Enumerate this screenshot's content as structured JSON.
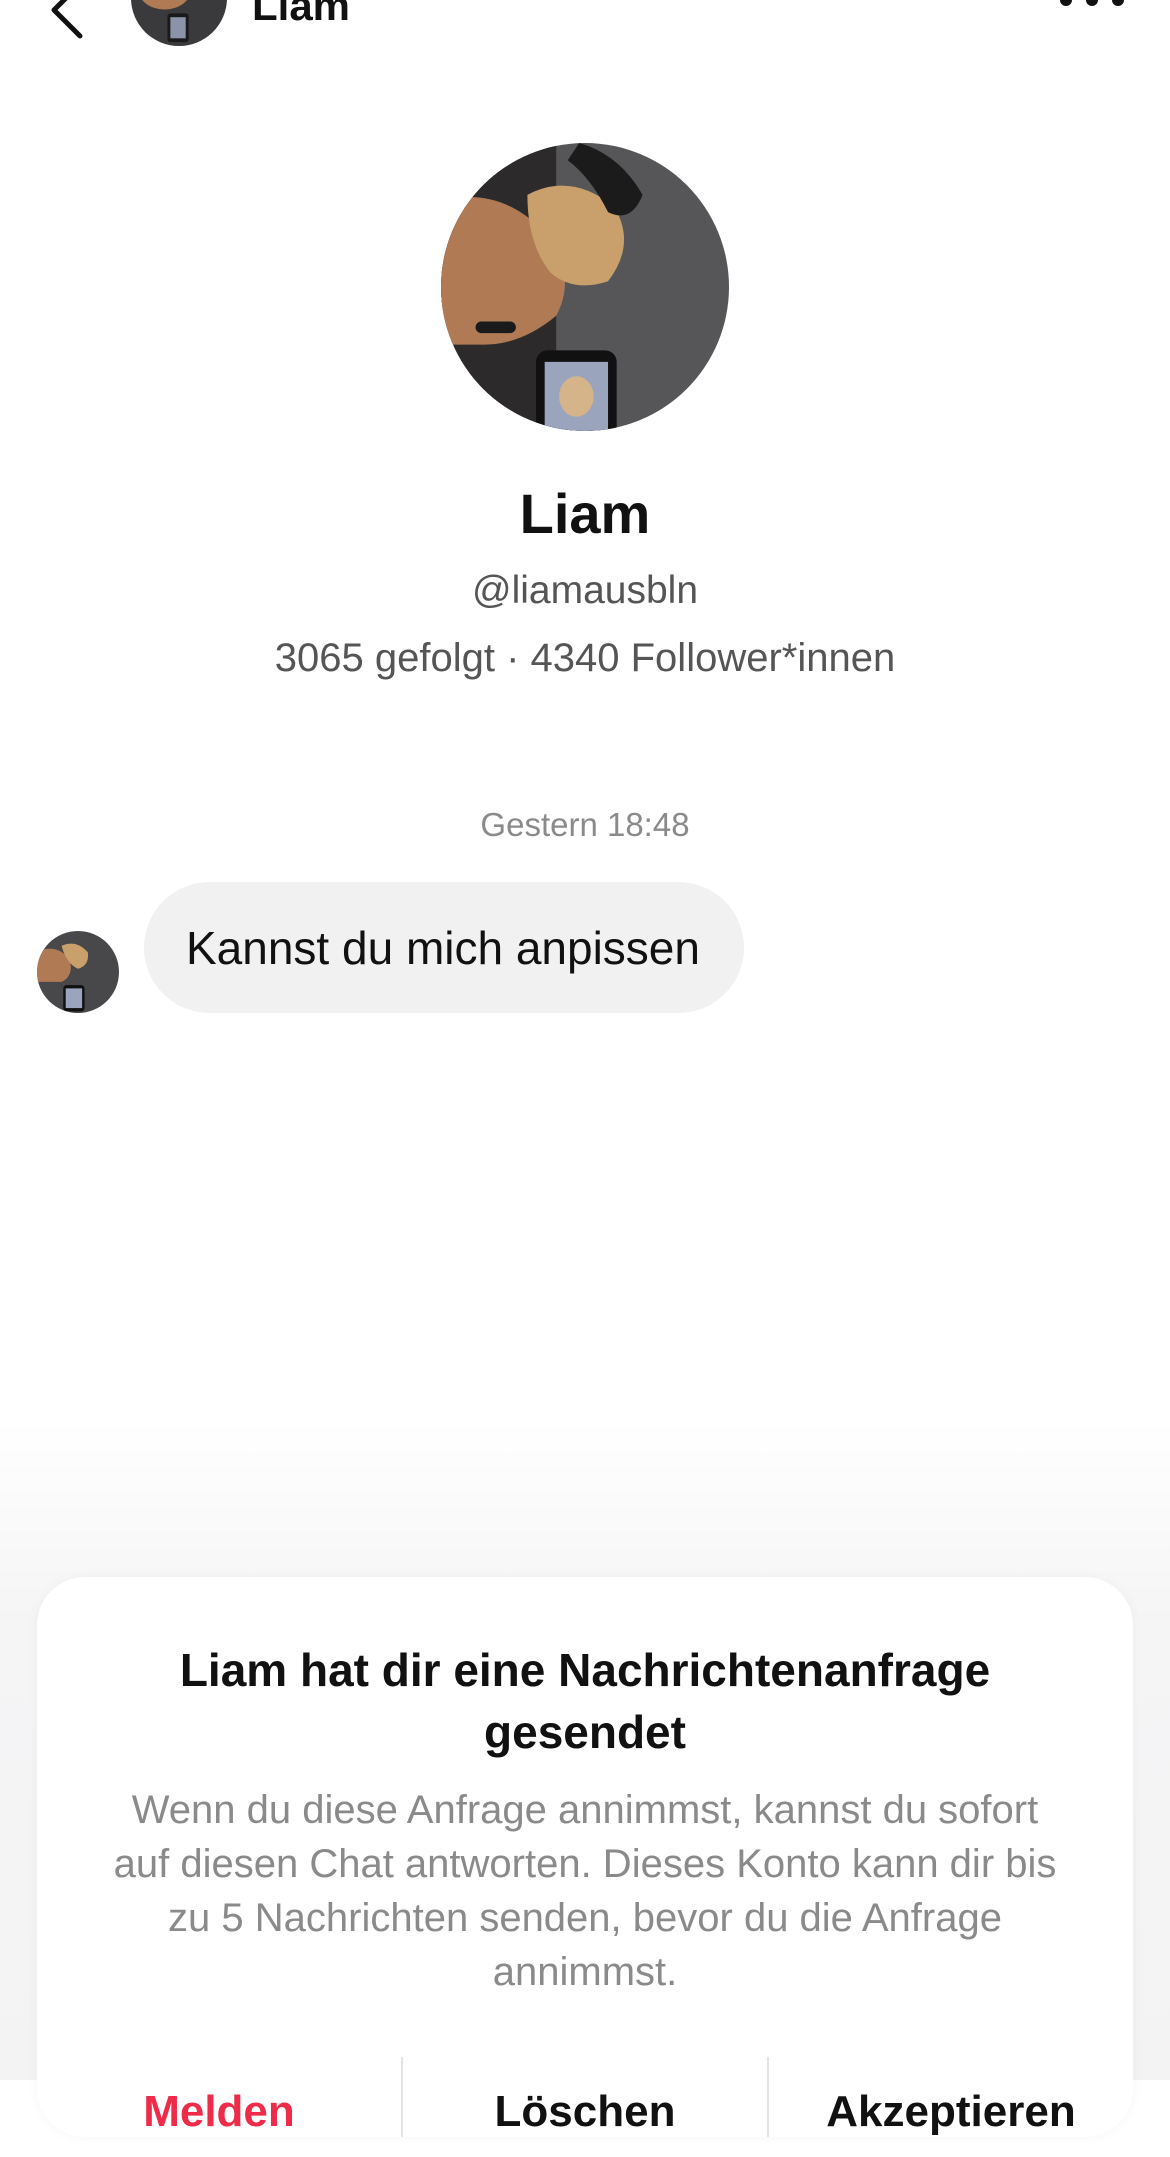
{
  "header": {
    "name": "Liam",
    "back_icon": "chevron-left-icon",
    "more_icon": "more-dots-icon"
  },
  "profile": {
    "name": "Liam",
    "handle": "@liamausbln",
    "stats": "3065 gefolgt · 4340 Follower*innen"
  },
  "chat": {
    "timestamp": "Gestern 18:48",
    "messages": [
      {
        "text": "Kannst du mich anpissen"
      }
    ]
  },
  "request_card": {
    "title": "Liam hat dir eine Nachrichtenanfrage gesendet",
    "body": "Wenn du diese Anfrage annimmst, kannst du sofort auf diesen Chat antworten. Dieses Konto kann dir bis zu 5 Nachrichten senden, bevor du die Anfrage annimmst.",
    "actions": {
      "report": "Melden",
      "delete": "Löschen",
      "accept": "Akzeptieren"
    }
  },
  "colors": {
    "report": "#ee2c4a",
    "bubble": "#f1f1f2",
    "muted_text": "#8a8a8a"
  }
}
